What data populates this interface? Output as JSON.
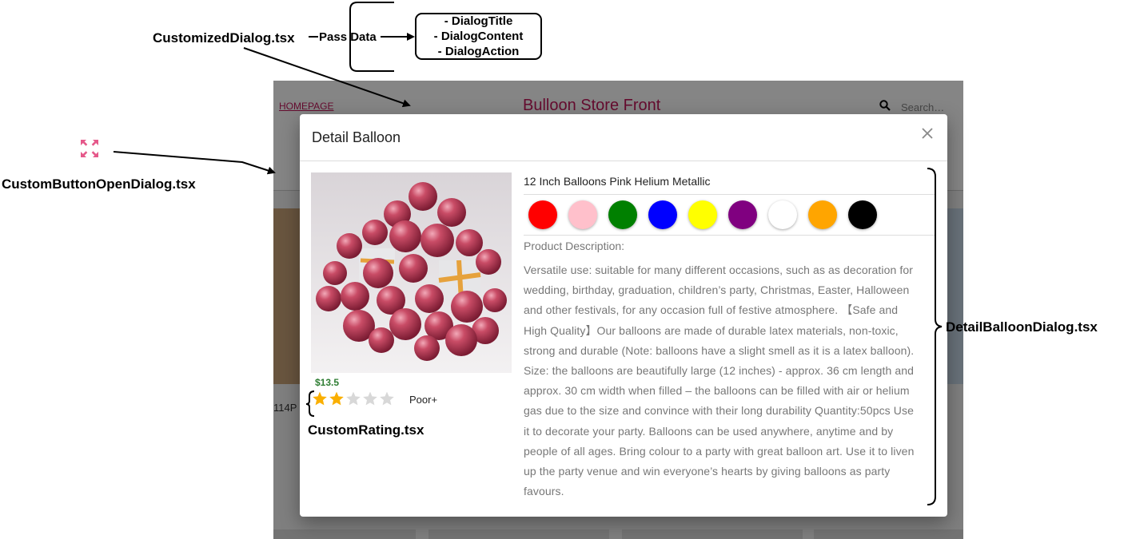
{
  "annotations": {
    "customized_dialog": "CustomizedDialog.tsx",
    "pass_data": "Pass Data",
    "dialog_parts": [
      "-  DialogTitle",
      "- DialogContent",
      "- DialogAction"
    ],
    "custom_button_open_dialog": "CustomButtonOpenDialog.tsx",
    "detail_balloon_dialog": "DetailBalloonDialog.tsx",
    "custom_rating": "CustomRating.tsx"
  },
  "store": {
    "homepage_link": "HOMEPAGE",
    "title": "Bulloon Store Front",
    "search_placeholder": "Search…",
    "partial_label": "114P"
  },
  "dialog": {
    "title": "Detail Balloon",
    "product_name": "12 Inch Balloons Pink Helium Metallic",
    "price": "$13.5",
    "rating": {
      "value": 2,
      "max": 5,
      "label": "Poor+"
    },
    "colors": [
      "#ff0000",
      "#ffc0cb",
      "#008000",
      "#0000ff",
      "#ffff00",
      "#800080",
      "#ffffff",
      "#ffa500",
      "#000000"
    ],
    "description_label": "Product Description:",
    "description_lines": [
      "Versatile use: suitable for many different occasions, such as as decoration for",
      "wedding, birthday, graduation, children’s party, Christmas, Easter, Halloween",
      "and other festivals, for any occasion full of festive atmosphere. 【Safe and",
      "High Quality】Our balloons are made of durable latex materials, non-toxic,",
      "strong and durable (Note: balloons have a slight smell as it is a latex balloon).",
      "Size: the balloons are beautifully large (12 inches) - approx. 36 cm length and",
      "approx. 30 cm width when filled – the balloons can be filled with air or helium",
      "gas due to the size and convince with their long durability Quantity:50pcs Use",
      "it to decorate your party. Balloons can be used anywhere, anytime and by",
      "people of all ages. Bring colour to a party with great balloon art. Use it to liven",
      "up the party venue and win everyone’s hearts by giving balloons as party",
      "favours."
    ]
  }
}
